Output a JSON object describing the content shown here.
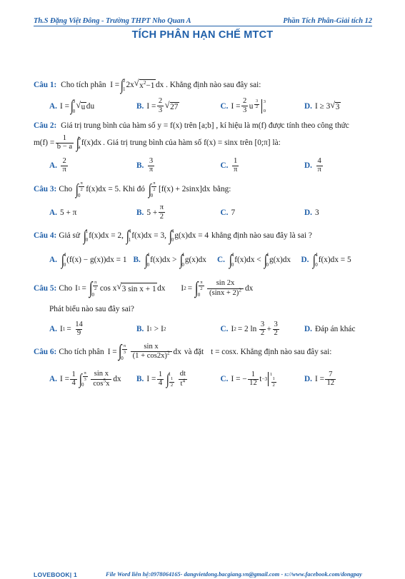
{
  "header": {
    "left": "Th.S Đặng Việt Đông - Trường THPT Nho Quan A",
    "right": "Phần Tích Phân-Giải tích 12"
  },
  "title": "TÍCH PHÂN HẠN CHẾ MTCT",
  "accent_color": "#1f5fa9",
  "questions": [
    {
      "label": "Câu 1:",
      "stem_before": "Cho tích phân",
      "stem_after": ". Khẳng định nào sau đây sai:",
      "integral": {
        "lower": "1",
        "upper": "2",
        "body": "2x√(x²−1)dx",
        "integrand_coef": "2x",
        "radicand": "x",
        "radicand_exp": "2",
        "radicand_tail": "−1",
        "dx": "dx"
      },
      "options": [
        {
          "tag": "A.",
          "text": "I = ∫₀³ √u du",
          "lhs": "I =",
          "lower": "0",
          "upper": "3",
          "radicand": "u",
          "tail": "du"
        },
        {
          "tag": "B.",
          "text": "I = (2/3)√27",
          "lhs": "I =",
          "num": "2",
          "den": "3",
          "radicand": "27"
        },
        {
          "tag": "C.",
          "text": "I = (2/3)u^(3/2) |₀³",
          "lhs": "I =",
          "num": "2",
          "den": "3",
          "var": "u",
          "exp_num": "3",
          "exp_den": "2",
          "eval_upper": "3",
          "eval_lower": "0"
        },
        {
          "tag": "D.",
          "text": "I ≥ 3√3",
          "lhs": "I ≥ 3",
          "radicand": "3"
        }
      ]
    },
    {
      "label": "Câu 2:",
      "line1_a": "Giá trị trung bình của hàm số",
      "line1_b": "y = f(x)",
      "line1_c": "trên",
      "line1_d": "[a;b]",
      "line1_e": ", kí hiệu là",
      "line1_f": "m(f)",
      "line1_g": "được tính theo công thức",
      "line2_a": "m(f) =",
      "line2_frac_num": "1",
      "line2_frac_den": "b − a",
      "line2_int_lower": "a",
      "line2_int_upper": "b",
      "line2_int_body": "f(x)dx",
      "line2_b": ". Giá trị trung bình của hàm số",
      "line2_c": "f(x) = sinx",
      "line2_d": "trên",
      "line2_e": "[0;π]",
      "line2_f": "là:",
      "options": [
        {
          "tag": "A.",
          "num": "2",
          "den": "π"
        },
        {
          "tag": "B.",
          "num": "3",
          "den": "π"
        },
        {
          "tag": "C.",
          "num": "1",
          "den": "π"
        },
        {
          "tag": "D.",
          "num": "4",
          "den": "π"
        }
      ]
    },
    {
      "label": "Câu 3:",
      "stem_a": "Cho",
      "int1": {
        "lower": "0",
        "upper_num": "π",
        "upper_den": "2",
        "body": "f(x)dx = 5"
      },
      "stem_b": ". Khi đó",
      "int2": {
        "lower": "0",
        "upper_num": "π",
        "upper_den": "2",
        "body": "[f(x) + 2sinx]dx"
      },
      "stem_c": "bằng:",
      "options": [
        {
          "tag": "A.",
          "text": "5 + π"
        },
        {
          "tag": "B.",
          "text": "5 +",
          "frac_num": "π",
          "frac_den": "2"
        },
        {
          "tag": "C.",
          "text": "7"
        },
        {
          "tag": "D.",
          "text": "3"
        }
      ]
    },
    {
      "label": "Câu 4:",
      "stem_a": "Giả sử",
      "int1": {
        "lower": "0",
        "upper": "1",
        "body": "f(x)dx = 2,"
      },
      "int2": {
        "lower": "1",
        "upper": "4",
        "body": "f(x)dx = 3,"
      },
      "int3": {
        "lower": "0",
        "upper": "4",
        "body": "g(x)dx = 4"
      },
      "stem_b": "khẳng định nào sau đây là sai ?",
      "options": [
        {
          "tag": "A.",
          "lower": "0",
          "upper": "4",
          "body": "(f(x) − g(x))dx = 1"
        },
        {
          "tag": "B.",
          "lower": "0",
          "upper": "4",
          "body": "f(x)dx >",
          "lower2": "0",
          "upper2": "4",
          "body2": "g(x)dx"
        },
        {
          "tag": "C.",
          "lower": "0",
          "upper": "4",
          "body": "f(x)dx <",
          "lower2": "0",
          "upper2": "4",
          "body2": "g(x)dx"
        },
        {
          "tag": "D.",
          "lower": "0",
          "upper": "4",
          "body": "f(x)dx = 5"
        }
      ]
    },
    {
      "label": "Câu 5:",
      "stem_a": "Cho",
      "i1_lhs": "I",
      "i1_sub": "1",
      "i1_eq": "=",
      "i1_lower": "0",
      "i1_upper_num": "π",
      "i1_upper_den": "2",
      "i1_body_a": "cos x",
      "i1_radicand": "3 sin x + 1",
      "i1_body_b": "dx",
      "i2_lhs": "I",
      "i2_sub": "2",
      "i2_eq": "=",
      "i2_lower": "0",
      "i2_upper_num": "π",
      "i2_upper_den": "2",
      "i2_num": "sin 2x",
      "i2_den": "(sinx + 2)",
      "i2_den_exp": "2",
      "i2_dx": "dx",
      "stem_b": "Phát biểu nào sau đây sai?",
      "options": [
        {
          "tag": "A.",
          "lhs": "I",
          "sub": "1",
          "eq": "=",
          "num": "14",
          "den": "9"
        },
        {
          "tag": "B.",
          "text": "I₁ > I₂",
          "lhs": "I",
          "sub": "1",
          "rel": ">",
          "rhs": "I",
          "sub2": "2"
        },
        {
          "tag": "C.",
          "lhs": "I",
          "sub": "2",
          "eq": "= 2 ln",
          "num": "3",
          "den": "2",
          "plus": "+",
          "num2": "3",
          "den2": "2"
        },
        {
          "tag": "D.",
          "text": "Đáp án khác"
        }
      ]
    },
    {
      "label": "Câu 6:",
      "stem_a": "Cho tích phân",
      "eq_lhs": "I =",
      "int_lower": "0",
      "int_upper_num": "π",
      "int_upper_den": "3",
      "int_num": "sin x",
      "int_den": "(1 + cos2x)",
      "int_den_exp": "2",
      "int_dx": "dx",
      "stem_b": "và đặt",
      "subst": "t = cosx",
      "stem_c": ". Khẳng định nào sau đây sai:",
      "options": [
        {
          "tag": "A.",
          "lhs": "I =",
          "num": "1",
          "den": "4",
          "lower": "0",
          "upper_num": "π",
          "upper_den": "3",
          "fnum": "sin x",
          "fden": "cos",
          "fden_exp": "5",
          "fden_tail": "x",
          "dx": "dx"
        },
        {
          "tag": "B.",
          "lhs": "I =",
          "num": "1",
          "den": "4",
          "lower_num": "1",
          "lower_den": "2",
          "upper": "1",
          "fnum": "dt",
          "fden": "t",
          "fden_exp": "4"
        },
        {
          "tag": "C.",
          "lhs": "I = −",
          "num": "1",
          "den": "12",
          "var": "t",
          "exp": "−3",
          "eval_upper": "1",
          "eval_lower_num": "1",
          "eval_lower_den": "2"
        },
        {
          "tag": "D.",
          "lhs": "I =",
          "num": "7",
          "den": "12"
        }
      ]
    }
  ],
  "footer": {
    "brand": "LOVEBOOK| 1",
    "contact": "File Word liên hệ:0978064165- dangvietdong.bacgiang.vn@gmail.com - s://www.facebook.com/dongpay"
  }
}
